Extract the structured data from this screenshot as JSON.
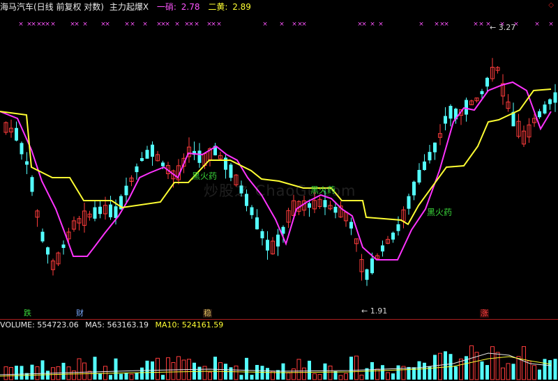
{
  "header": {
    "title": "海马汽车(日线 前复权 对数)",
    "indicator": "主力起爆X",
    "line1_label": "一硝:",
    "line1_value": "2.78",
    "line2_label": "二黄:",
    "line2_value": "2.89",
    "corner_symbol": "◇"
  },
  "volume_header": {
    "volume_label": "VOLUME:",
    "volume_value": "554723.06",
    "ma5_label": "MA5:",
    "ma5_value": "563163.19",
    "ma10_label": "MA10:",
    "ma10_value": "524161.59"
  },
  "colors": {
    "up": "#ff3c3c",
    "down": "#54ffff",
    "ma_magenta": "#ff33ff",
    "ma_yellow": "#ffff33",
    "marker": "#ff55ff",
    "separator": "#aa1e1e"
  },
  "markers": {
    "glyph": "×"
  },
  "annotations": {
    "high_label": "3.27",
    "low_label": "1.91",
    "fire_label_1": "黑火药",
    "fire_label_2": "黑火药",
    "fire_label_3": "黑火药",
    "tag_die": "跌",
    "tag_cai": "财",
    "tag_wen": "稳",
    "tag_zhang": "涨",
    "watermark": "炒股之 ChaoGu.com"
  },
  "chart_data": {
    "type": "candlestick",
    "title": "海马汽车(日线 前复权 对数)",
    "scale": "log",
    "price_range": [
      1.85,
      3.35
    ],
    "extremes": {
      "high": 3.27,
      "low": 1.91
    },
    "series": [
      {
        "name": "一硝",
        "last": 2.78
      },
      {
        "name": "二黄",
        "last": 2.89
      },
      {
        "name": "VOLUME",
        "last": 554723.06
      },
      {
        "name": "MA5",
        "last": 563163.19
      },
      {
        "name": "MA10",
        "last": 524161.59
      }
    ]
  }
}
